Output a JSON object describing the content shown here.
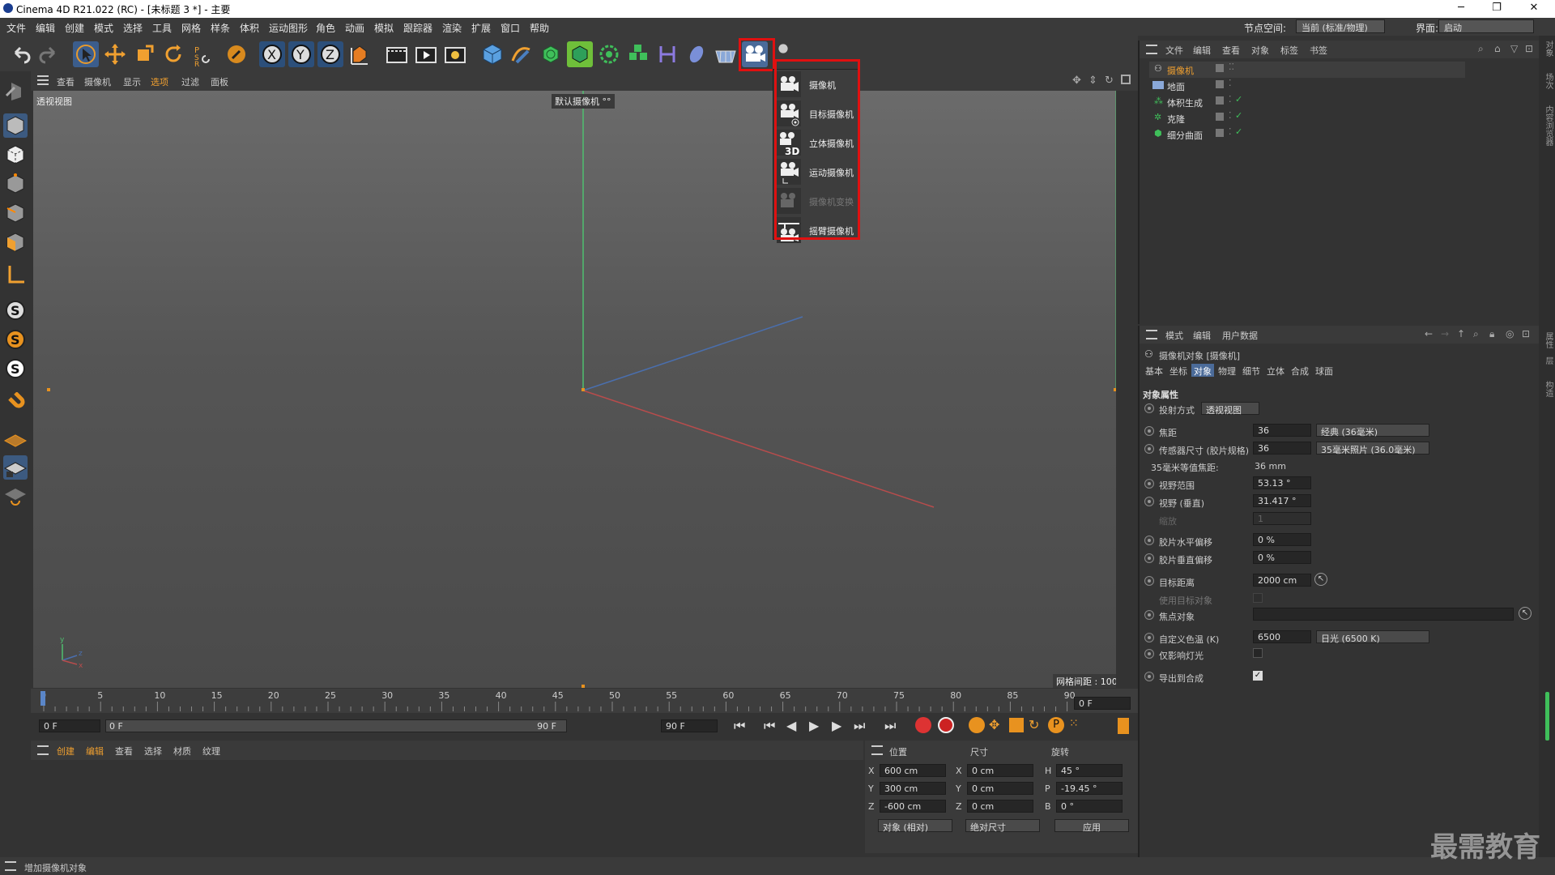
{
  "titlebar": {
    "title": "Cinema 4D R21.022 (RC) - [未标题 3 *] - 主要",
    "minimize": "─",
    "maximize": "❐",
    "close": "✕"
  },
  "menubar": {
    "items": [
      "文件",
      "编辑",
      "创建",
      "模式",
      "选择",
      "工具",
      "网格",
      "样条",
      "体积",
      "运动图形",
      "角色",
      "动画",
      "模拟",
      "跟踪器",
      "渲染",
      "扩展",
      "窗口",
      "帮助"
    ],
    "node_space_label": "节点空间:",
    "node_space_value": "当前 (标准/物理)",
    "layout_label": "界面:",
    "layout_value": "启动"
  },
  "viewport": {
    "menu": [
      "查看",
      "摄像机",
      "显示",
      "选项",
      "过滤",
      "面板"
    ],
    "name": "透视视图",
    "camera": "默认摄像机 °°",
    "grid_spacing": "网格间距 : 100 cm"
  },
  "camera_popup": {
    "items": [
      {
        "label": "摄像机",
        "enabled": true
      },
      {
        "label": "目标摄像机",
        "enabled": true
      },
      {
        "label": "立体摄像机",
        "enabled": true
      },
      {
        "label": "运动摄像机",
        "enabled": true
      },
      {
        "label": "摄像机变换",
        "enabled": false
      },
      {
        "label": "摇臂摄像机",
        "enabled": true
      }
    ],
    "highlight_color": "#e01010"
  },
  "timeline": {
    "ticks": [
      "0",
      "5",
      "10",
      "15",
      "20",
      "25",
      "30",
      "35",
      "40",
      "45",
      "50",
      "55",
      "60",
      "65",
      "70",
      "75",
      "80",
      "85",
      "90"
    ],
    "current_frame_right": "0 F"
  },
  "playbar": {
    "start": "0 F",
    "range_start": "0 F",
    "range_end": "90 F",
    "end": "90 F"
  },
  "material_manager": {
    "menu": [
      "创建",
      "编辑",
      "查看",
      "选择",
      "材质",
      "纹理"
    ]
  },
  "coordinates": {
    "headers": [
      "位置",
      "尺寸",
      "旋转"
    ],
    "rows": [
      {
        "axis": "X",
        "pos": "600 cm",
        "size_axis": "X",
        "size": "0 cm",
        "rot_axis": "H",
        "rot": "45 °"
      },
      {
        "axis": "Y",
        "pos": "300 cm",
        "size_axis": "Y",
        "size": "0 cm",
        "rot_axis": "P",
        "rot": "-19.45 °"
      },
      {
        "axis": "Z",
        "pos": "-600 cm",
        "size_axis": "Z",
        "size": "0 cm",
        "rot_axis": "B",
        "rot": "0 °"
      }
    ],
    "mode": "对象 (相对)",
    "size_mode": "绝对尺寸",
    "apply": "应用"
  },
  "status": {
    "text": "增加摄像机对象"
  },
  "object_manager": {
    "menu": [
      "文件",
      "编辑",
      "查看",
      "对象",
      "标签",
      "书签"
    ],
    "objects": [
      {
        "name": "摄像机",
        "selected": true,
        "icon": "camera-icon"
      },
      {
        "name": "地面",
        "selected": false,
        "icon": "floor-icon"
      },
      {
        "name": "体积生成",
        "selected": false,
        "icon": "volume-builder-icon"
      },
      {
        "name": "克隆",
        "selected": false,
        "icon": "cloner-icon"
      },
      {
        "name": "细分曲面",
        "selected": false,
        "icon": "subdivision-icon"
      }
    ]
  },
  "attribute_manager": {
    "menu": [
      "模式",
      "编辑",
      "用户数据"
    ],
    "object_title": "摄像机对象 [摄像机]",
    "tabs": [
      "基本",
      "坐标",
      "对象",
      "物理",
      "细节",
      "立体",
      "合成",
      "球面"
    ],
    "active_tab": "对象",
    "section": "对象属性",
    "projection_label": "投射方式",
    "projection_value": "透视视图",
    "focal_label": "焦距",
    "focal_value": "36",
    "focal_preset": "经典 (36毫米)",
    "sensor_label": "传感器尺寸 (胶片规格)",
    "sensor_value": "36",
    "sensor_preset": "35毫米照片 (36.0毫米)",
    "equiv_label": "35毫米等值焦距:",
    "equiv_value": "36 mm",
    "fov_label": "视野范围",
    "fov_value": "53.13 °",
    "fov_v_label": "视野 (垂直)",
    "fov_v_value": "31.417 °",
    "zoom_label": "缩放",
    "zoom_value": "1",
    "film_h_label": "胶片水平偏移",
    "film_h_value": "0 %",
    "film_v_label": "胶片垂直偏移",
    "film_v_value": "0 %",
    "target_dist_label": "目标距离",
    "target_dist_value": "2000 cm",
    "use_target_label": "使用目标对象",
    "focus_obj_label": "焦点对象",
    "focus_obj_value": "",
    "color_temp_label": "自定义色温 (K)",
    "color_temp_value": "6500",
    "color_temp_preset": "日光 (6500 K)",
    "affect_lights_label": "仅影响灯光",
    "export_comp_label": "导出到合成"
  },
  "right_strip": {
    "labels": [
      "对象",
      "场次",
      "内容浏览器",
      "属性",
      "层",
      "构造"
    ]
  },
  "watermark": "最需教育"
}
